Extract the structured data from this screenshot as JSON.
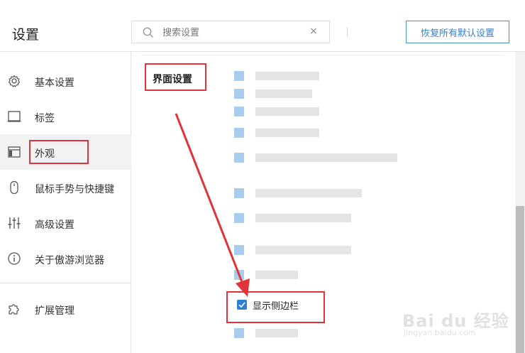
{
  "header": {
    "title": "设置",
    "search_placeholder": "搜索设置",
    "clear_symbol": "×",
    "restore_button": "恢复所有默认设置"
  },
  "sidebar": {
    "items": [
      {
        "label": "基本设置",
        "icon": "gear-icon"
      },
      {
        "label": "标签",
        "icon": "tab-icon"
      },
      {
        "label": "外观",
        "icon": "window-icon",
        "active": true
      },
      {
        "label": "鼠标手势与快捷键",
        "icon": "mouse-icon"
      },
      {
        "label": "高级设置",
        "icon": "sliders-icon"
      },
      {
        "label": "关于傲游浏览器",
        "icon": "info-icon"
      },
      {
        "label": "扩展管理",
        "icon": "puzzle-icon"
      }
    ]
  },
  "main": {
    "section_title": "界面设置",
    "sidebar_checkbox": {
      "label": "显示侧边栏",
      "checked": true
    }
  },
  "watermark": {
    "logo": "Bai du 经验",
    "url": "jingyan.baidu.com"
  },
  "colors": {
    "accent": "#2f7fd6",
    "highlight_box": "#e0343a",
    "restore_border": "#4a90d9"
  }
}
